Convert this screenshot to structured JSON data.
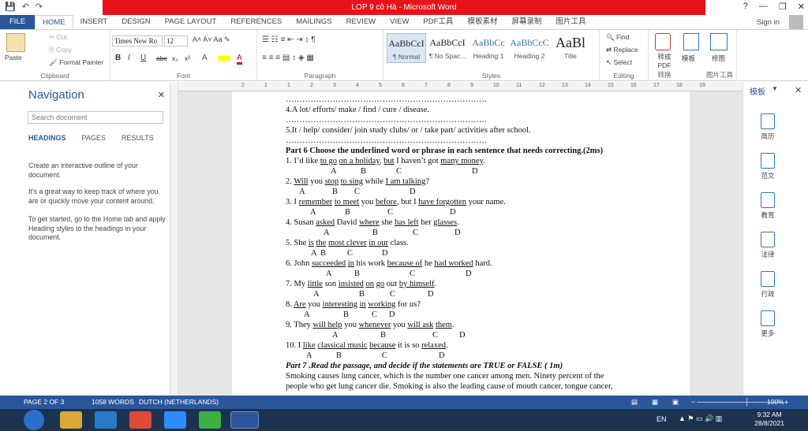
{
  "window": {
    "title": "LOP 9 cô Hà  -  Microsoft Word",
    "help": "?",
    "minimize": "—",
    "restore": "❐",
    "close": "✕"
  },
  "quick_access": {
    "save": "💾",
    "undo": "↶",
    "redo": "↷"
  },
  "tabs": [
    "FILE",
    "HOME",
    "INSERT",
    "DESIGN",
    "PAGE LAYOUT",
    "REFERENCES",
    "MAILINGS",
    "REVIEW",
    "VIEW",
    "PDF工具",
    "模板素材",
    "屏幕录制",
    "图片工具"
  ],
  "account": {
    "sign_in": "Sign in"
  },
  "ribbon": {
    "clipboard": {
      "label": "Clipboard",
      "paste": "Paste",
      "cut": "Cut",
      "copy": "Copy",
      "format_painter": "Format Painter"
    },
    "font": {
      "label": "Font",
      "name": "Times New Ro",
      "size": "12",
      "buttons": [
        "B",
        "I",
        "U",
        "abc",
        "x₂",
        "x²",
        "A",
        "A"
      ]
    },
    "paragraph": {
      "label": "Paragraph"
    },
    "styles": {
      "label": "Styles",
      "items": [
        {
          "preview": "AaBbCcI",
          "name": "¶ Normal"
        },
        {
          "preview": "AaBbCcI",
          "name": "¶ No Spac..."
        },
        {
          "preview": "AaBbCc",
          "name": "Heading 1"
        },
        {
          "preview": "AaBbCcC",
          "name": "Heading 2"
        },
        {
          "preview": "AaBl",
          "name": "Title"
        }
      ]
    },
    "editing": {
      "label": "Editing",
      "find": "Find",
      "replace": "Replace",
      "select": "Select"
    },
    "extra": {
      "to_pdf": "转成PDF",
      "template": "模板",
      "repair": "修图",
      "g1": "转换",
      "g2": "模板中心",
      "g3": "图片工具"
    }
  },
  "navigation": {
    "title": "Navigation",
    "search_placeholder": "Search document",
    "tabs": [
      "HEADINGS",
      "PAGES",
      "RESULTS"
    ],
    "p1": "Create an interactive outline of your document.",
    "p2": "It's a great way to keep track of where you are or quickly move your content around.",
    "p3": "To get started, go to the Home tab and apply Heading styles to the headings in your document."
  },
  "ruler": [
    "2",
    "1",
    "1",
    "2",
    "3",
    "4",
    "5",
    "6",
    "7",
    "8",
    "9",
    "10",
    "11",
    "12",
    "13",
    "14",
    "15",
    "16",
    "17",
    "18",
    "19"
  ],
  "document": {
    "dots1": "……………………………………………………………….",
    "q4": "4.A lot/ efforts/ make / find / cure / disease.",
    "dots2": "……………………………………………………………….",
    "q5": "5.It / help/ consider/ join study clubs/ or / take part/ activities after school.",
    "dots3": "……………………………………………………………….",
    "part6": "Part 6 Choose the underlined word or phrase in each sentence that needs correcting.(2ms)",
    "s1": "1. I'd like to go on a holiday, but I haven't got many money.",
    "s2": "2. Will you stop to sing while I am talking?",
    "s3": "3. I remember to meet you before, but I have forgotten your name.",
    "s4": "4. Susan asked David where she has left her glasses.",
    "s5": "5. She is the most clever in our class.",
    "s6": "6. John succeeded in his work because of he had worked hard.",
    "s7": "7. My little son insisted on go out by himself.",
    "s8": "8. Are you interesting in working for us?",
    "s9": "9. They will help you whenever you will ask them.",
    "s10": "10. I like classical music because it is so relaxed.",
    "letters": {
      "a": "A",
      "b": "B",
      "c": "C",
      "d": "D"
    },
    "part7": "Part 7 .Read the passage, and decide if the statements are TRUE or FALSE ( 1m)",
    "p7l1": "Smoking causes lung cancer, which is the number one cancer among men. Ninety percent of the",
    "p7l2": "people who get lung cancer die. Smoking is also the leading cause of mouth cancer, tongue cancer,"
  },
  "right_pane": {
    "title": "模板",
    "items": [
      "简历",
      "范文",
      "教育",
      "法律",
      "行政",
      "更多"
    ]
  },
  "status": {
    "page": "PAGE 2 OF 3",
    "words": "1058 WORDS",
    "lang": "DUTCH (NETHERLANDS)",
    "zoom": "100%"
  },
  "taskbar": {
    "lang": "EN",
    "time": "9:32 AM",
    "date": "28/8/2021"
  },
  "colors": {
    "accent": "#2b579a",
    "title_red": "#e8121b"
  }
}
